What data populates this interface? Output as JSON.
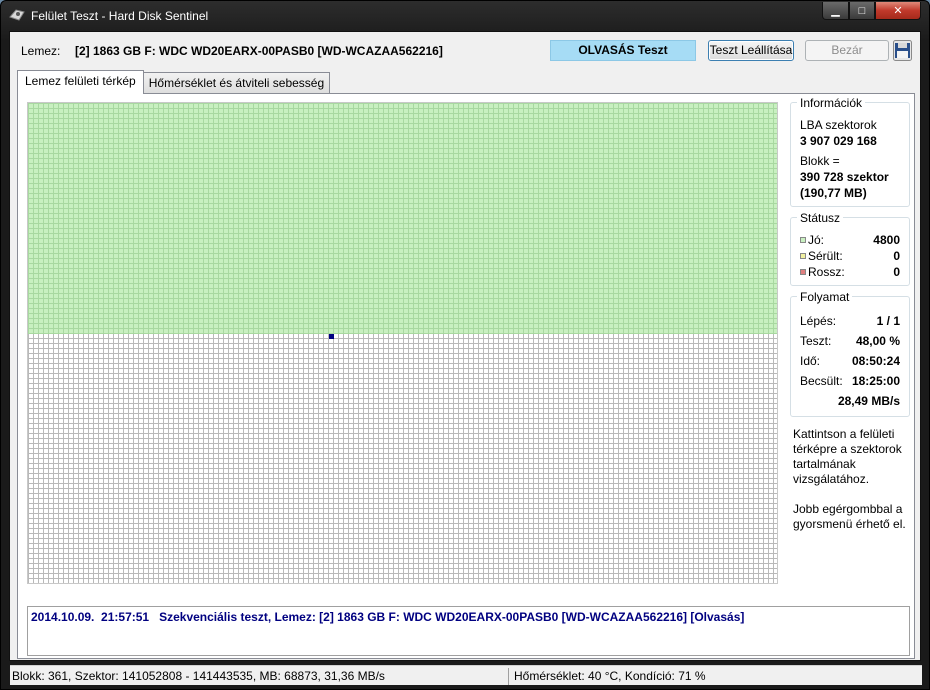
{
  "window": {
    "title": "Felület Teszt - Hard Disk Sentinel",
    "min_label": "▁",
    "max_label": "□",
    "close_label": "✕"
  },
  "header": {
    "disk_label": "Lemez:",
    "disk_value": "[2] 1863 GB F: WDC WD20EARX-00PASB0 [WD-WCAZAA562216]",
    "test_badge": "OLVASÁS Teszt",
    "stop_button": "Teszt Leállítása",
    "close_button": "Bezár",
    "save_icon": "floppy-disk-icon"
  },
  "tabs": [
    {
      "label": "Lemez felületi térkép",
      "active": true
    },
    {
      "label": "Hőmérséklet és átviteli sebesség",
      "active": false
    }
  ],
  "surface_map": {
    "blocks_total": 10000,
    "progress_fraction": 0.48,
    "colors": {
      "good": "#c8f0c0",
      "untested": "#ffffff",
      "current": "#000080"
    }
  },
  "info": {
    "title": "Információk",
    "lba_label": "LBA szektorok",
    "lba_value": "3 907 029 168",
    "block_label": "Blokk =",
    "block_value1": "390 728 szektor",
    "block_value2": "(190,77 MB)"
  },
  "status": {
    "title": "Státusz",
    "good_label": "Jó:",
    "good_value": "4800",
    "good_color": "#c8f0c0",
    "damaged_label": "Sérült:",
    "damaged_value": "0",
    "damaged_color": "#f0f0a0",
    "bad_label": "Rossz:",
    "bad_value": "0",
    "bad_color": "#e08080"
  },
  "progress": {
    "title": "Folyamat",
    "step_label": "Lépés:",
    "step_value": "1 / 1",
    "test_label": "Teszt:",
    "test_value": "48,00 %",
    "time_label": "Idő:",
    "time_value": "08:50:24",
    "est_label": "Becsült:",
    "est_value": "18:25:00",
    "speed_value": "28,49 MB/s"
  },
  "help": {
    "p1": "Kattintson a felületi térképre a szektorok tartalmának vizsgálatához.",
    "p2": "Jobb egérgombbal a gyorsmenü érhető el."
  },
  "log": {
    "line": "2014.10.09.  21:57:51   Szekvenciális teszt, Lemez: [2] 1863 GB F: WDC WD20EARX-00PASB0 [WD-WCAZAA562216] [Olvasás]"
  },
  "statusbar": {
    "left": "Blokk: 361, Szektor: 141052808 - 141443535, MB: 68873, 31,36 MB/s",
    "right": "Hőmérséklet: 40  °C, Kondíció: 71 %"
  }
}
